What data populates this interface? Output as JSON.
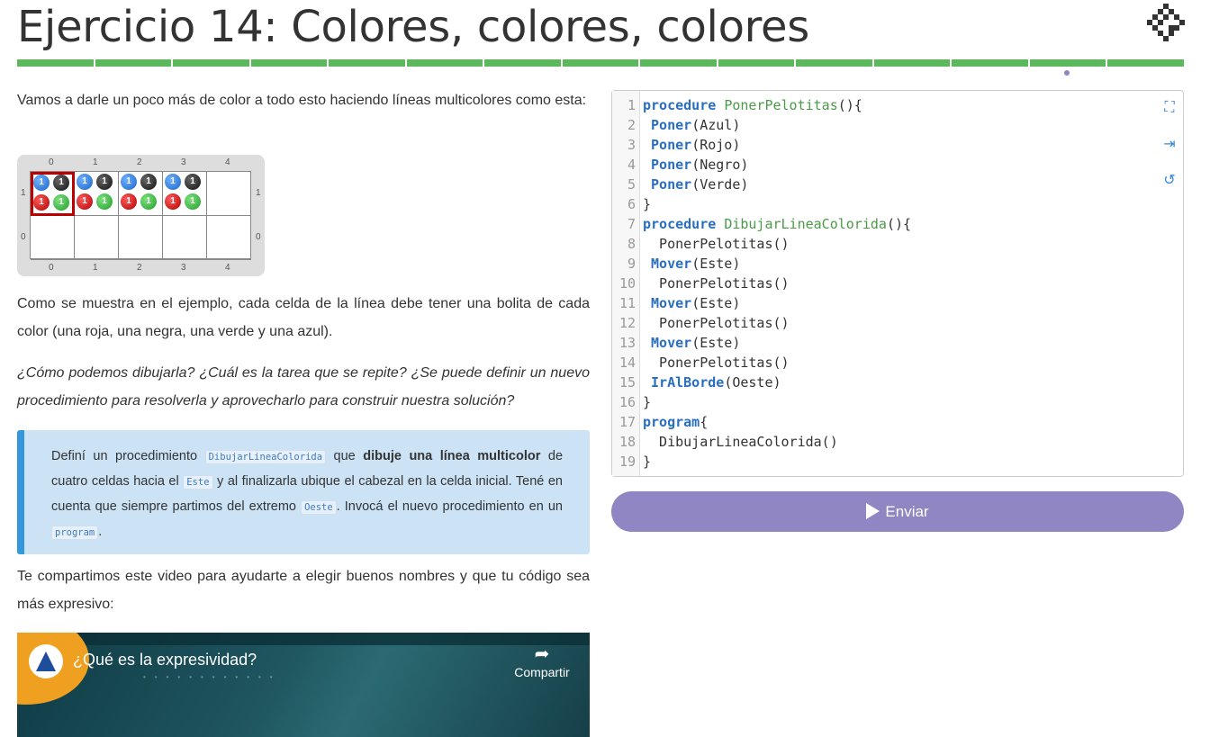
{
  "header": {
    "title": "Ejercicio 14: Colores, colores, colores",
    "logo_icon": "mumuki-diamond-icon",
    "progress_segments": 15,
    "progress_color": "#5cb85c",
    "accent_color": "#8f86c3"
  },
  "content": {
    "intro": "Vamos a darle un poco más de color a todo esto haciendo líneas multicolores como esta:",
    "board": {
      "columns": [
        "0",
        "1",
        "2",
        "3",
        "4"
      ],
      "rows": [
        "1",
        "0"
      ],
      "ball_count": "1",
      "ball_colors": [
        "blue",
        "black",
        "red",
        "green"
      ]
    },
    "explanation": "Como se muestra en el ejemplo, cada celda de la línea debe tener una bolita de cada color (una roja, una negra, una verde y una azul).",
    "questions": "¿Cómo podemos dibujarla? ¿Cuál es la tarea que se repite? ¿Se puede definir un nuevo procedimiento para resolverla y aprovecharlo para construir nuestra solución?",
    "callout": {
      "t1": "Definí un procedimiento ",
      "code1": "DibujarLineaColorida",
      "t2": " que ",
      "bold": "dibuje una línea multicolor",
      "t3": " de cuatro celdas hacia el ",
      "code2": "Este",
      "t4": " y al finalizarla ubique el cabezal en la celda inicial. Tené en cuenta que siempre partimos del extremo ",
      "code3": "Oeste",
      "t5": ". Invocá el nuevo procedimiento en un ",
      "code4": "program",
      "t6": "."
    },
    "video_intro": "Te compartimos este video para ayudarte a elegir buenos nombres y que tu código sea más expresivo:",
    "video": {
      "title": "¿Qué es la expresividad?",
      "share_label": "Compartir"
    }
  },
  "editor": {
    "lines": [
      {
        "n": "1",
        "parts": [
          [
            "kw",
            "procedure"
          ],
          [
            "",
            "  "
          ],
          [
            "fn",
            "PonerPelotitas"
          ],
          [
            "",
            "(){"
          ]
        ]
      },
      {
        "n": "2",
        "parts": [
          [
            "",
            "  "
          ],
          [
            "kw",
            "Poner"
          ],
          [
            "",
            "(Azul)"
          ]
        ]
      },
      {
        "n": "3",
        "parts": [
          [
            "",
            "  "
          ],
          [
            "kw",
            "Poner"
          ],
          [
            "",
            "(Rojo)"
          ]
        ]
      },
      {
        "n": "4",
        "parts": [
          [
            "",
            "  "
          ],
          [
            "kw",
            "Poner"
          ],
          [
            "",
            "(Negro)"
          ]
        ]
      },
      {
        "n": "5",
        "parts": [
          [
            "",
            "  "
          ],
          [
            "kw",
            "Poner"
          ],
          [
            "",
            "(Verde)"
          ]
        ]
      },
      {
        "n": "6",
        "parts": [
          [
            "",
            "}"
          ]
        ]
      },
      {
        "n": "7",
        "parts": [
          [
            "kw",
            "procedure"
          ],
          [
            "",
            "  "
          ],
          [
            "fn",
            "DibujarLineaColorida"
          ],
          [
            "",
            "(){"
          ]
        ]
      },
      {
        "n": "8",
        "parts": [
          [
            "",
            "  PonerPelotitas()"
          ]
        ]
      },
      {
        "n": "9",
        "parts": [
          [
            "",
            "  "
          ],
          [
            "kw",
            "Mover"
          ],
          [
            "",
            "(Este)"
          ]
        ]
      },
      {
        "n": "10",
        "parts": [
          [
            "",
            "  PonerPelotitas()"
          ]
        ]
      },
      {
        "n": "11",
        "parts": [
          [
            "",
            "  "
          ],
          [
            "kw",
            "Mover"
          ],
          [
            "",
            "(Este)"
          ]
        ]
      },
      {
        "n": "12",
        "parts": [
          [
            "",
            "  PonerPelotitas()"
          ]
        ]
      },
      {
        "n": "13",
        "parts": [
          [
            "",
            "  "
          ],
          [
            "kw",
            "Mover"
          ],
          [
            "",
            "(Este)"
          ]
        ]
      },
      {
        "n": "14",
        "parts": [
          [
            "",
            "  PonerPelotitas()"
          ]
        ]
      },
      {
        "n": "15",
        "parts": [
          [
            "",
            "  "
          ],
          [
            "kw",
            "IrAlBorde"
          ],
          [
            "",
            "(Oeste)"
          ]
        ]
      },
      {
        "n": "16",
        "parts": [
          [
            "",
            "}"
          ]
        ]
      },
      {
        "n": "17",
        "parts": [
          [
            "kw",
            "program"
          ],
          [
            "",
            "{"
          ]
        ]
      },
      {
        "n": "18",
        "parts": [
          [
            "",
            "  DibujarLineaColorida()"
          ]
        ]
      },
      {
        "n": "19",
        "parts": [
          [
            "",
            "}"
          ]
        ]
      }
    ],
    "icons": [
      "fullscreen-icon",
      "indent-icon",
      "reset-icon"
    ]
  },
  "submit": {
    "label": "Enviar",
    "icon": "play-icon"
  }
}
